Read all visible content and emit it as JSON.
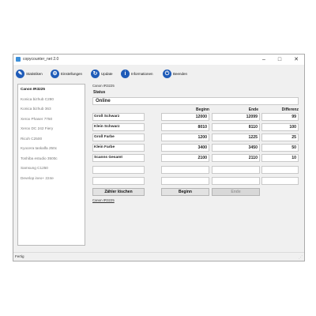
{
  "window": {
    "title": "copycounter_net 2.0",
    "controls": {
      "minimize": "–",
      "maximize": "□",
      "close": "✕"
    }
  },
  "toolbar": [
    {
      "label": "Statistiken",
      "icon": "statistics-icon",
      "glyph": "✎"
    },
    {
      "label": "Einstellungen",
      "icon": "settings-icon",
      "glyph": "⚙"
    },
    {
      "label": "Update",
      "icon": "update-icon",
      "glyph": "↻"
    },
    {
      "label": "Informationen",
      "icon": "info-icon",
      "glyph": "i"
    },
    {
      "label": "Beenden",
      "icon": "power-icon",
      "glyph": "⏻"
    }
  ],
  "devices": [
    "Canon IR3225",
    "Konica bizhub C280",
    "Konica bizhub 363",
    "Xerox Phaser 7750",
    "Xerox DC 242 Fiery",
    "Ricoh C2500",
    "Kyocera taskalfa 250c",
    "Toshiba estudio 3500c",
    "Samsung C1250",
    "Develop ineo+ 224e"
  ],
  "selected_device": "Canon IR3225",
  "panel": {
    "caption": "Canon IR3225",
    "status_label": "Status",
    "status_value": "Online",
    "headers": {
      "begin": "Beginn",
      "end": "Ende",
      "diff": "Differenz"
    },
    "rows": [
      {
        "label": "Groß Schwarz",
        "begin": "12000",
        "end": "12099",
        "diff": "99"
      },
      {
        "label": "Klein Schwarz",
        "begin": "8010",
        "end": "8110",
        "diff": "100"
      },
      {
        "label": "Groß Farbe",
        "begin": "1200",
        "end": "1225",
        "diff": "25"
      },
      {
        "label": "Klein Farbe",
        "begin": "3400",
        "end": "3450",
        "diff": "50"
      },
      {
        "label": "Scanns Gesamt",
        "begin": "2100",
        "end": "2110",
        "diff": "10"
      }
    ],
    "buttons": {
      "reset": "Zähler löschen",
      "begin": "Beginn",
      "end": "Ende"
    },
    "footer_link": "Canon IR3225"
  },
  "statusbar": {
    "text": "Fertig"
  }
}
